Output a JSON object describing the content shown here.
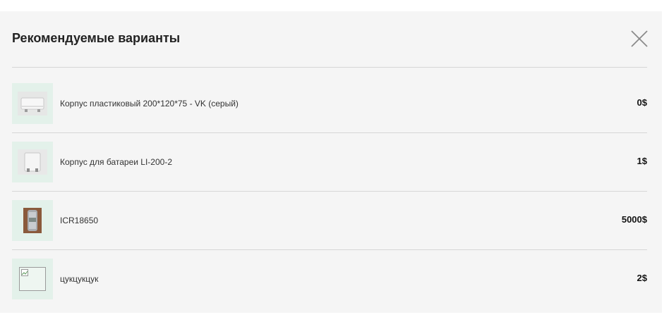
{
  "modal": {
    "title": "Рекомендуемые варианты",
    "close_icon": "close-icon"
  },
  "items": [
    {
      "name": "Корпус пластиковый 200*120*75 - VK (серый)",
      "price": "0$",
      "thumb": "gray-enclosure-photo"
    },
    {
      "name": "Корпус для батареи LI-200-2",
      "price": "1$",
      "thumb": "battery-enclosure-photo"
    },
    {
      "name": "ICR18650",
      "price": "5000$",
      "thumb": "battery-cell-photo"
    },
    {
      "name": "цукцукцук",
      "price": "2$",
      "thumb": "broken-image-icon"
    }
  ]
}
